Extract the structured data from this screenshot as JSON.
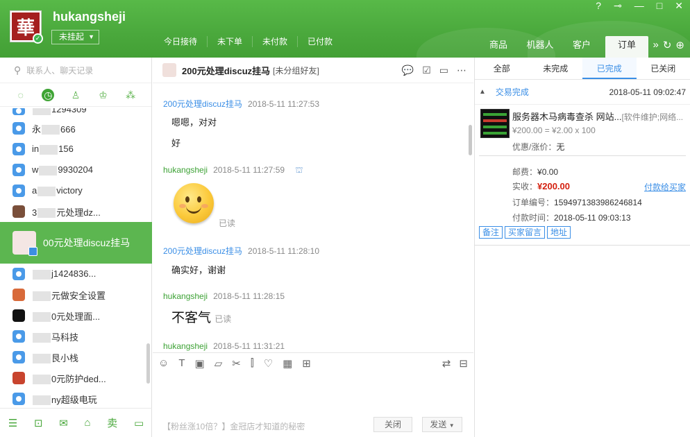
{
  "header": {
    "logo_char": "華",
    "username": "hukangsheji",
    "status": "未挂起",
    "tabs": [
      "今日接待",
      "未下单",
      "未付款",
      "已付款"
    ],
    "right_tabs": [
      "商品",
      "机器人",
      "客户",
      "订单"
    ],
    "active_right_tab": "订单",
    "accent": "#4aa83c"
  },
  "sidebar": {
    "search_placeholder": "联系人、聊天记录",
    "contacts": [
      {
        "prefix": "",
        "suffix": "1294309"
      },
      {
        "prefix": "永",
        "suffix": "666"
      },
      {
        "prefix": "in",
        "suffix": "156"
      },
      {
        "prefix": "w",
        "suffix": "9930204"
      },
      {
        "prefix": "a",
        "suffix": "victory"
      },
      {
        "prefix": "3",
        "suffix": "元处理dz..."
      },
      {
        "prefix": "",
        "suffix": "00元处理discuz挂马"
      },
      {
        "prefix": "",
        "suffix": "j1424836..."
      },
      {
        "prefix": "",
        "suffix": "元做安全设置"
      },
      {
        "prefix": "",
        "suffix": "0元处理面..."
      },
      {
        "prefix": "",
        "suffix": "马科技"
      },
      {
        "prefix": "",
        "suffix": "艮小栈"
      },
      {
        "prefix": "",
        "suffix": "0元防护ded..."
      },
      {
        "prefix": "",
        "suffix": "ny超级电玩"
      }
    ]
  },
  "chat": {
    "title": "200元处理discuz挂马",
    "tag": "[未分组好友]",
    "messages": [
      {
        "sender": "200元处理discuz挂马",
        "time": "2018-5-11 11:27:53",
        "lines": [
          "嗯嗯，对对",
          "好"
        ]
      },
      {
        "sender": "hukangsheji",
        "time": "2018-5-11 11:27:59",
        "read": "已读"
      },
      {
        "sender": "200元处理discuz挂马",
        "time": "2018-5-11 11:28:10",
        "lines": [
          "确实好，谢谢"
        ]
      },
      {
        "sender": "hukangsheji",
        "time": "2018-5-11 11:28:15",
        "big": "不客气",
        "read": "已读"
      },
      {
        "sender": "hukangsheji",
        "time": "2018-5-11 11:31:21"
      }
    ],
    "promo": "【粉丝涨10倍？】金冠店才知道的秘密",
    "close_label": "关闭",
    "send_label": "发送"
  },
  "orders": {
    "tabs": [
      "全部",
      "未完成",
      "已完成",
      "已关闭"
    ],
    "active_tab": "已完成",
    "status": "交易完成",
    "datetime": "2018-05-11 09:02:47",
    "product_name": "服务器木马病毒查杀 网站...",
    "product_category": "[软件维护;网络...",
    "price_line": "¥200.00 = ¥2.00 x 100",
    "discount_label": "优惠/涨价：",
    "discount_value": "无",
    "shipping_label": "邮费：",
    "shipping_value": "¥0.00",
    "paid_label": "实收：",
    "paid_value": "¥200.00",
    "pay_link": "付款给买家",
    "order_no_label": "订单编号：",
    "order_no": "1594971383986246814",
    "pay_time_label": "付款时间：",
    "pay_time": "2018-05-11 09:03:13",
    "buttons": [
      "备注",
      "买家留言",
      "地址"
    ]
  }
}
